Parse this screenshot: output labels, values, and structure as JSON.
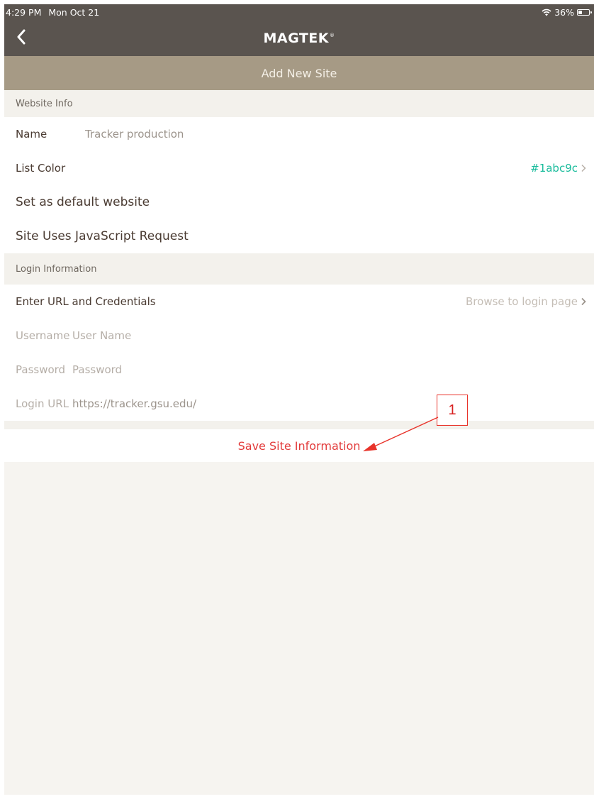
{
  "status": {
    "time": "4:29 PM",
    "date": "Mon Oct 21",
    "battery": "36%",
    "battery_level": 0.36
  },
  "nav": {
    "logo": "MAGTEK",
    "trademark": "®"
  },
  "title": "Add New Site",
  "website_info": {
    "header": "Website Info",
    "name_label": "Name",
    "name_value": "Tracker production",
    "list_color_label": "List Color",
    "list_color_value": "#1abc9c",
    "default_label": "Set as default website",
    "js_label": "Site Uses JavaScript Request"
  },
  "login_info": {
    "header": "Login Information",
    "enter_label": "Enter URL and Credentials",
    "browse_label": "Browse to login page",
    "username_label": "Username",
    "username_placeholder": "User Name",
    "password_label": "Password",
    "password_placeholder": "Password",
    "url_label": "Login URL",
    "url_value": "https://tracker.gsu.edu/"
  },
  "save_label": "Save Site Information",
  "callout": "1",
  "colors": {
    "nav": "#5a544f",
    "title_bar": "#a69a85",
    "accent": "#1abc9c",
    "save": "#e23a3a"
  },
  "icons": [
    "chevron-left-icon",
    "wifi-icon",
    "battery-icon",
    "chevron-right-icon"
  ]
}
